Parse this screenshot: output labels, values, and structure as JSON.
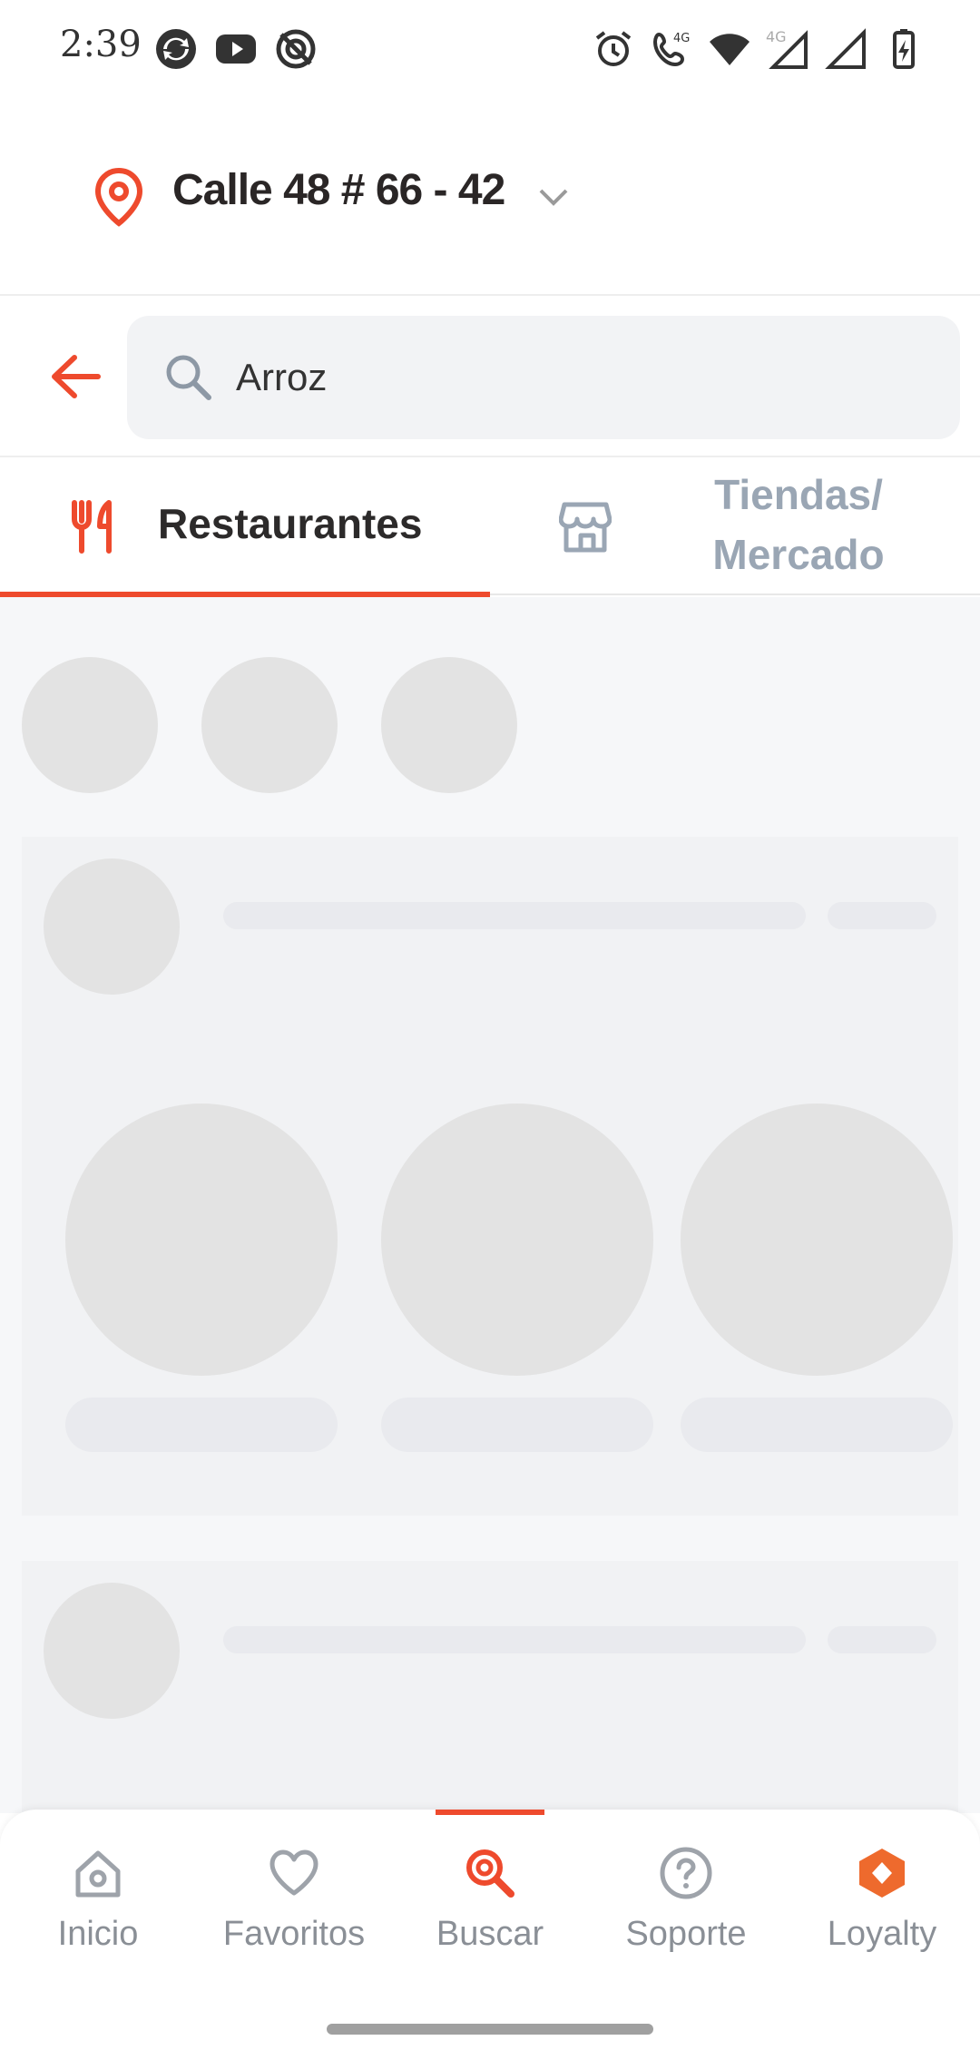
{
  "status_bar": {
    "time": "2:39",
    "left_icons": [
      "sync-icon",
      "youtube-icon",
      "no-signal-app-icon"
    ],
    "right_icons": [
      "alarm-icon",
      "volte-call-icon",
      "wifi-icon",
      "signal-4g-icon",
      "signal-icon",
      "battery-charging-icon"
    ],
    "network_label": "4G"
  },
  "address": {
    "label": "Calle 48 # 66 - 42",
    "icon": "location-pin-icon"
  },
  "search": {
    "value": "Arroz",
    "placeholder": ""
  },
  "tabs": [
    {
      "label": "Restaurantes",
      "icon": "restaurant-icon",
      "active": true
    },
    {
      "label": "Tiendas/\nMercado",
      "label_line1": "Tiendas/",
      "label_line2": "Mercado",
      "icon": "store-icon",
      "active": false
    }
  ],
  "bottom_nav": [
    {
      "label": "Inicio",
      "icon": "home-icon"
    },
    {
      "label": "Favoritos",
      "icon": "heart-icon"
    },
    {
      "label": "Buscar",
      "icon": "search-icon",
      "active": true
    },
    {
      "label": "Soporte",
      "icon": "help-icon"
    },
    {
      "label": "Loyalty",
      "icon": "loyalty-icon"
    }
  ],
  "colors": {
    "accent": "#ee4a2d",
    "inactive_tab": "#9aa6b4",
    "skeleton": "#e3e3e3",
    "background": "#f6f7f9"
  }
}
